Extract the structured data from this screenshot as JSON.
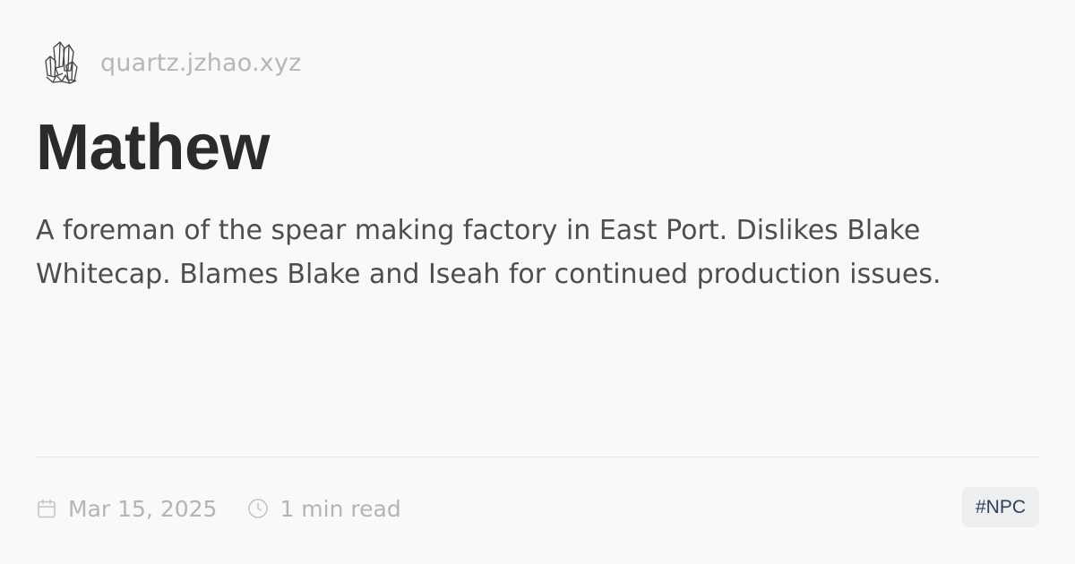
{
  "site": {
    "logo_icon": "crystal-cluster-icon",
    "name": "quartz.jzhao.xyz"
  },
  "page": {
    "title": "Mathew",
    "description": "A foreman of the spear making factory in East Port. Dislikes Blake Whitecap. Blames Blake and Iseah for continued production issues."
  },
  "meta": {
    "date_icon": "calendar-icon",
    "date": "Mar 15, 2025",
    "reading_time_icon": "clock-icon",
    "reading_time": "1 min read"
  },
  "tags": [
    {
      "label": "#NPC"
    }
  ],
  "colors": {
    "background": "#faf8f8",
    "title": "#2b2b2b",
    "body_text": "#4e4e4e",
    "muted_text": "#b4b4b4",
    "tag_background": "#eceef0",
    "tag_text": "#2f4358"
  }
}
